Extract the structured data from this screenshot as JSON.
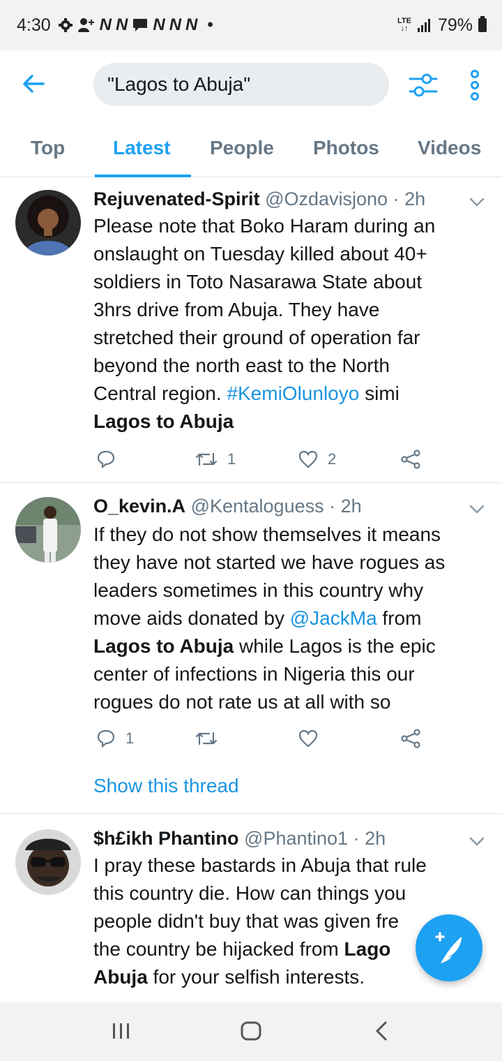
{
  "status_bar": {
    "time": "4:30",
    "notification_icons": [
      "N",
      "N",
      "N",
      "N",
      "N"
    ],
    "network": "LTE",
    "battery": "79%"
  },
  "search": {
    "query": "\"Lagos to Abuja\""
  },
  "tabs": [
    {
      "label": "Top",
      "active": false
    },
    {
      "label": "Latest",
      "active": true
    },
    {
      "label": "People",
      "active": false
    },
    {
      "label": "Photos",
      "active": false
    },
    {
      "label": "Videos",
      "active": false
    }
  ],
  "tweets": [
    {
      "name": "Rejuvenated-Spirit",
      "handle": "@Ozdavisjono",
      "time": "2h",
      "text_1": "Please note that Boko Haram during an\nonslaught on Tuesday killed about 40+\nsoldiers in Toto Nasarawa State about\n3hrs drive from Abuja. They have\nstretched their ground of operation far\nbeyond the north east to the North\nCentral region. ",
      "hashtag": "#KemiOlunloyo",
      "text_2": " simi\n",
      "bold": "Lagos to Abuja",
      "replies": "",
      "retweets": "1",
      "likes": "2"
    },
    {
      "name": "O_kevin.A",
      "handle": "@Kentaloguess",
      "time": "2h",
      "text_1": "If they do not show themselves it means\nthey have not started we have rogues as\nleaders sometimes in this country why\nmove aids donated by ",
      "mention": "@JackMa",
      "text_2": "  from\n",
      "bold": "Lagos to Abuja",
      "text_3": " while Lagos is the epic\ncenter of infections in Nigeria this our\nrogues do not rate us at all with so",
      "replies": "1",
      "retweets": "",
      "likes": "",
      "show_thread": "Show this thread"
    },
    {
      "name": "$h£ikh Phantino",
      "handle": "@Phantino1",
      "time": "2h",
      "text_1": "I pray these bastards in Abuja that rule\nthis country die. How can things you\npeople didn't buy that was given fre\nthe country be hijacked from ",
      "bold_1": "Lago",
      "text_2": "\n",
      "bold_2": "Abuja",
      "text_3": " for your selfish interests."
    }
  ],
  "colors": {
    "accent": "#1da1f2",
    "link": "#1b95e0",
    "secondary_text": "#657786",
    "divider": "#dfe3e7"
  }
}
